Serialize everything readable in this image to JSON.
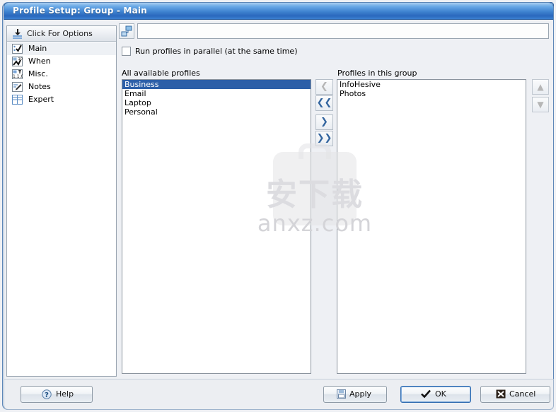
{
  "window": {
    "title": "Profile Setup: Group - Main"
  },
  "sidebar": {
    "header_label": "Click For Options",
    "header_icon": "options-icon",
    "items": [
      {
        "label": "Main",
        "icon": "check-icon",
        "selected": true
      },
      {
        "label": "When",
        "icon": "clock-icon",
        "selected": false
      },
      {
        "label": "Misc.",
        "icon": "numbers-icon",
        "selected": false
      },
      {
        "label": "Notes",
        "icon": "pencil-icon",
        "selected": false
      },
      {
        "label": "Expert",
        "icon": "grid-icon",
        "selected": false
      }
    ]
  },
  "toolbar": {
    "icon": "profile-node-icon",
    "field_value": "",
    "field_placeholder": ""
  },
  "main": {
    "parallel_checkbox": {
      "label": "Run profiles in parallel (at the same time)",
      "checked": false
    },
    "available": {
      "caption": "All available profiles",
      "items": [
        {
          "label": "Business",
          "selected": true
        },
        {
          "label": "Email",
          "selected": false
        },
        {
          "label": "Laptop",
          "selected": false
        },
        {
          "label": "Personal",
          "selected": false
        }
      ]
    },
    "group": {
      "caption": "Profiles in this group",
      "items": [
        {
          "label": "InfoHesive",
          "selected": false
        },
        {
          "label": "Photos",
          "selected": false
        }
      ]
    },
    "transfer_buttons": [
      {
        "name": "remove-one-button",
        "glyph": "❮",
        "enabled": false
      },
      {
        "name": "remove-all-button",
        "glyph": "❮❮",
        "enabled": true
      },
      {
        "name": "add-one-button",
        "glyph": "❯",
        "enabled": true
      },
      {
        "name": "add-all-button",
        "glyph": "❯❯",
        "enabled": true
      }
    ],
    "order_buttons": [
      {
        "name": "move-up-button",
        "glyph": "▲",
        "enabled": false
      },
      {
        "name": "move-down-button",
        "glyph": "▼",
        "enabled": false
      }
    ]
  },
  "watermark": {
    "cn_text": "安下载",
    "site": "anxz.com"
  },
  "footer": {
    "help": {
      "label": "Help",
      "icon": "question-icon"
    },
    "apply": {
      "label": "Apply",
      "icon": "save-icon"
    },
    "ok": {
      "label": "OK",
      "icon": "check-icon"
    },
    "cancel": {
      "label": "Cancel",
      "icon": "cross-icon"
    }
  },
  "colors": {
    "title_blue": "#2a68bd",
    "selection_blue": "#2c5fa8",
    "accent_arrow": "#33659f",
    "disabled_gray": "#b6b6b6"
  }
}
